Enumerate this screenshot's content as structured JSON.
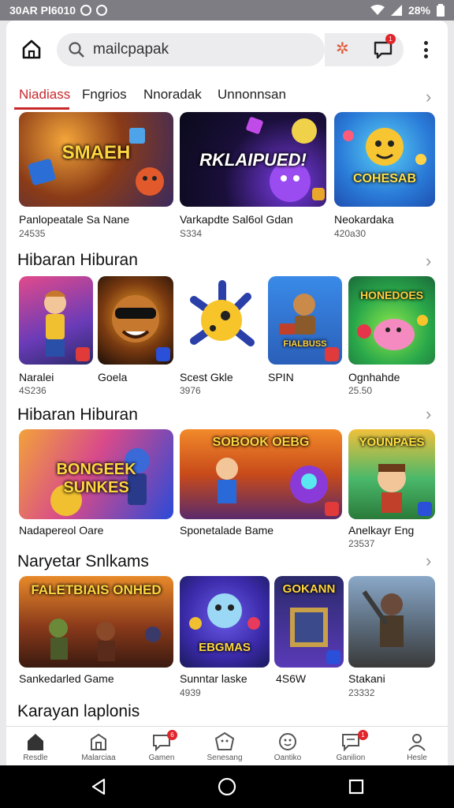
{
  "status": {
    "left": "30AR Pl6010",
    "battery": "28%"
  },
  "search": {
    "query": "mailcpapak"
  },
  "badges": {
    "message": "1",
    "games": "6",
    "collection": "1"
  },
  "tabs": [
    "Niadiass",
    "Fngrios",
    "Nnoradak",
    "Unnonnsan"
  ],
  "section1": {
    "items": [
      {
        "tile_text": "SMAEH",
        "name": "Panlopeatale Sa Nane",
        "meta": "24535"
      },
      {
        "tile_text": "RKLAIPUED!",
        "name": "Varkapdte Sal6ol Gdan",
        "meta": "S334"
      },
      {
        "tile_text": "COHESAB",
        "name": "Neokardaka",
        "meta": "420a30"
      }
    ]
  },
  "section2": {
    "title": "Hibaran Hiburan",
    "items": [
      {
        "tile_text": "",
        "name": "Naralei",
        "meta": "4S236"
      },
      {
        "tile_text": "",
        "name": "Goela",
        "meta": ""
      },
      {
        "tile_text": "",
        "name": "Scest Gkle",
        "meta": "3976"
      },
      {
        "tile_text": "FIALBUSS",
        "name": "SPIN",
        "meta": ""
      },
      {
        "tile_text": "HONEDOES",
        "name": "Ognhahde",
        "meta": "25.50"
      }
    ]
  },
  "section3": {
    "title": "Hibaran Hiburan",
    "items": [
      {
        "tile_text": "BONGEEK  SUNKES",
        "name": "Nadapereol Oare",
        "meta": ""
      },
      {
        "tile_text": "SOBOOK   OEBG",
        "name": "Sponetalade Bame",
        "meta": ""
      },
      {
        "tile_text": "YOUNPAES",
        "name": "Anelkayr Eng",
        "meta": "23537"
      }
    ]
  },
  "section4": {
    "title": "Naryetar Snlkams",
    "items": [
      {
        "tile_text": "FALETBIAIS  ONHED",
        "name": "Sankedarled Game",
        "meta": ""
      },
      {
        "tile_text": "EBGMAS",
        "name": "Sunntar laske",
        "meta": "4939"
      },
      {
        "tile_text": "GOKANN",
        "name": "4S6W",
        "meta": ""
      },
      {
        "tile_text": "",
        "name": "Stakani",
        "meta": "23332"
      }
    ]
  },
  "section5": {
    "title": "Karayan laplonis"
  },
  "bottom_nav": [
    {
      "label": "Resdle",
      "icon": "home-icon"
    },
    {
      "label": "Malarciaa",
      "icon": "store-icon"
    },
    {
      "label": "Gamen",
      "icon": "chat-icon"
    },
    {
      "label": "Senesang",
      "icon": "face-icon"
    },
    {
      "label": "Oantiko",
      "icon": "smiley-icon"
    },
    {
      "label": "Ganilion",
      "icon": "comment-icon"
    },
    {
      "label": "Hesle",
      "icon": "profile-icon"
    }
  ],
  "colors": {
    "accent": "#c8282b",
    "badge": "#e0262b",
    "statusbar": "#7d7d83"
  }
}
